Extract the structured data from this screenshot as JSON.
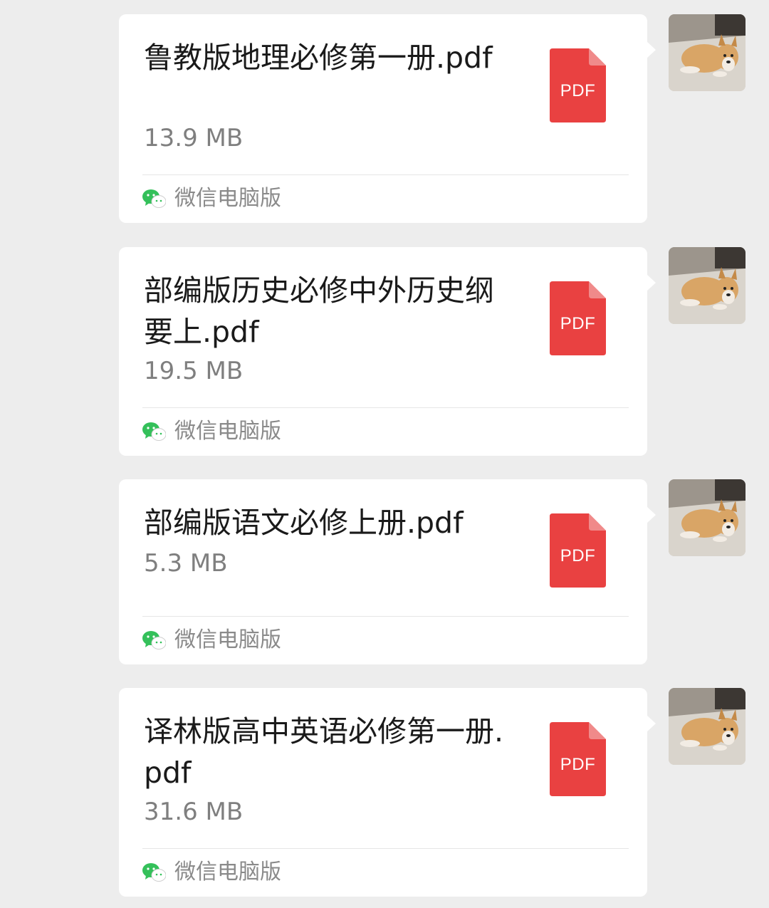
{
  "colors": {
    "background": "#ededed",
    "bubble": "#ffffff",
    "pdf_red": "#e94141",
    "wechat_green": "#34c05a"
  },
  "messages": [
    {
      "file_name": "鲁教版地理必修第一册.pdf",
      "file_size": "13.9 MB",
      "icon_label": "PDF",
      "source_label": "微信电脑版",
      "source_icon": "wechat-icon"
    },
    {
      "file_name": "部编版历史必修中外历史纲要上.pdf",
      "file_size": "19.5 MB",
      "icon_label": "PDF",
      "source_label": "微信电脑版",
      "source_icon": "wechat-icon"
    },
    {
      "file_name": "部编版语文必修上册.pdf",
      "file_size": "5.3 MB",
      "icon_label": "PDF",
      "source_label": "微信电脑版",
      "source_icon": "wechat-icon"
    },
    {
      "file_name": "译林版高中英语必修第一册.pdf",
      "file_size": "31.6 MB",
      "icon_label": "PDF",
      "source_label": "微信电脑版",
      "source_icon": "wechat-icon"
    }
  ]
}
